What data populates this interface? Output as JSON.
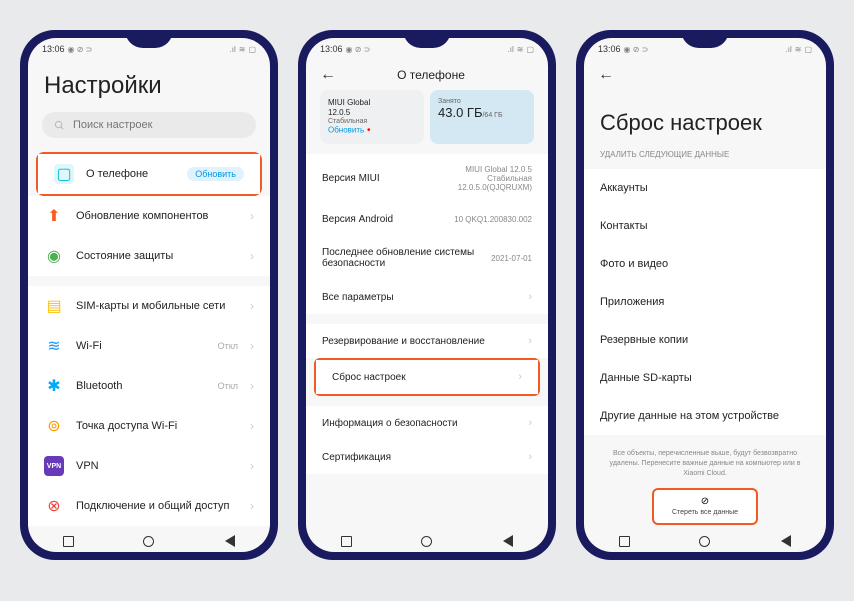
{
  "status": {
    "time": "13:06",
    "icons": "⬚◉⊃",
    "signal": "📶",
    "battery": "🔋"
  },
  "nav": {
    "back": "◀",
    "home": "●",
    "recent": "■"
  },
  "p1": {
    "title": "Настройки",
    "search_placeholder": "Поиск настроек",
    "items": [
      {
        "icon": "📱",
        "color": "#00bcd4",
        "label": "О телефоне",
        "badge": "Обновить",
        "highlight": true
      },
      {
        "icon": "⬆",
        "color": "#ff5722",
        "label": "Обновление компонентов",
        "chevron": true
      },
      {
        "icon": "✓",
        "color": "#4caf50",
        "label": "Состояние защиты",
        "chevron": true
      }
    ],
    "items2": [
      {
        "icon": "⊞",
        "color": "#ffc107",
        "label": "SIM-карты и мобильные сети",
        "chevron": true
      },
      {
        "icon": "≋",
        "color": "#2196f3",
        "label": "Wi-Fi",
        "trail": "Откл",
        "chevron": true
      },
      {
        "icon": "✱",
        "color": "#03a9f4",
        "label": "Bluetooth",
        "trail": "Откл",
        "chevron": true
      },
      {
        "icon": "∞",
        "color": "#ff9800",
        "label": "Точка доступа Wi-Fi",
        "chevron": true
      },
      {
        "icon": "⊡",
        "color": "#673ab7",
        "label": "VPN",
        "chevron": true
      },
      {
        "icon": "⊗",
        "color": "#f44336",
        "label": "Подключение и общий доступ",
        "chevron": true
      }
    ]
  },
  "p2": {
    "title": "О телефоне",
    "card1": {
      "line1": "MIUI Global",
      "line2": "12.0.5",
      "line3": "Стабильная",
      "update": "Обновить"
    },
    "card2": {
      "label": "Занято",
      "value": "43.0 ГБ",
      "total": "/64 ГБ"
    },
    "details": [
      {
        "label": "Версия MIUI",
        "value": "MIUI Global 12.0.5 Стабильная 12.0.5.0(QJQRUXM)"
      },
      {
        "label": "Версия Android",
        "value": "10 QKQ1.200830.002"
      },
      {
        "label": "Последнее обновление системы безопасности",
        "value": "2021-07-01"
      },
      {
        "label": "Все параметры",
        "value": "",
        "chevron": true
      }
    ],
    "details2": [
      {
        "label": "Резервирование и восстановление",
        "chevron": true
      },
      {
        "label": "Сброс настроек",
        "chevron": true,
        "highlight": true
      }
    ],
    "details3": [
      {
        "label": "Информация о безопасности",
        "chevron": true
      },
      {
        "label": "Сертификация",
        "chevron": true
      }
    ]
  },
  "p3": {
    "title": "Сброс настроек",
    "subtitle": "Удалить следующие данные",
    "items": [
      "Аккаунты",
      "Контакты",
      "Фото и видео",
      "Приложения",
      "Резервные копии",
      "Данные SD-карты",
      "Другие данные на этом устройстве"
    ],
    "note": "Все объекты, перечисленные выше, будут безвозвратно удалены. Перенесите важные данные на компьютер или в Xiaomi Cloud.",
    "erase_label": "Стереть все данные"
  }
}
